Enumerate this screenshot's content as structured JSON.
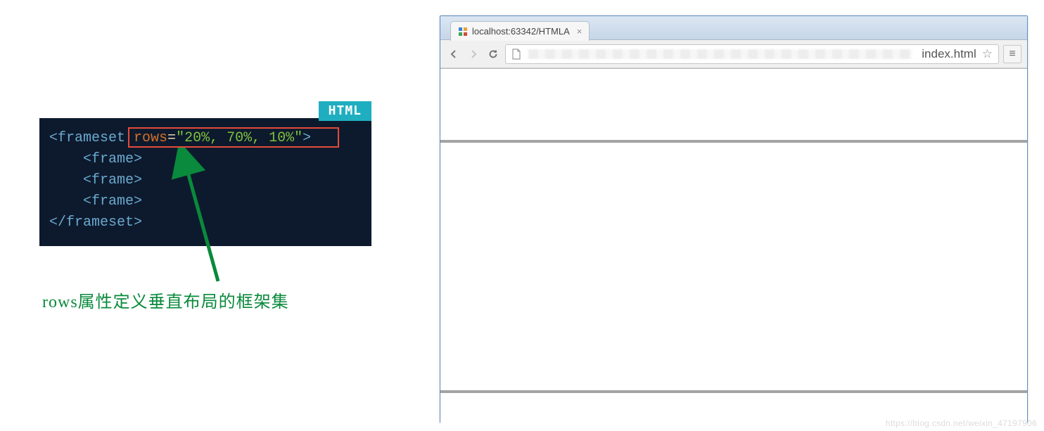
{
  "code": {
    "badge": "HTML",
    "frameset_open": "<frameset ",
    "attr_name": "rows",
    "equals": "=",
    "attr_value": "\"20%, 70%, 10%\"",
    "close_gt": ">",
    "frame_tag": "<frame>",
    "frameset_close": "</frameset>"
  },
  "annotation_text": "rows属性定义垂直布局的框架集",
  "browser": {
    "tab_title": "localhost:63342/HTMLA",
    "url_tail": "index.html"
  },
  "frameset_rows": [
    "20%",
    "70%",
    "10%"
  ],
  "watermark": "https://blog.csdn.net/weixin_47197906"
}
